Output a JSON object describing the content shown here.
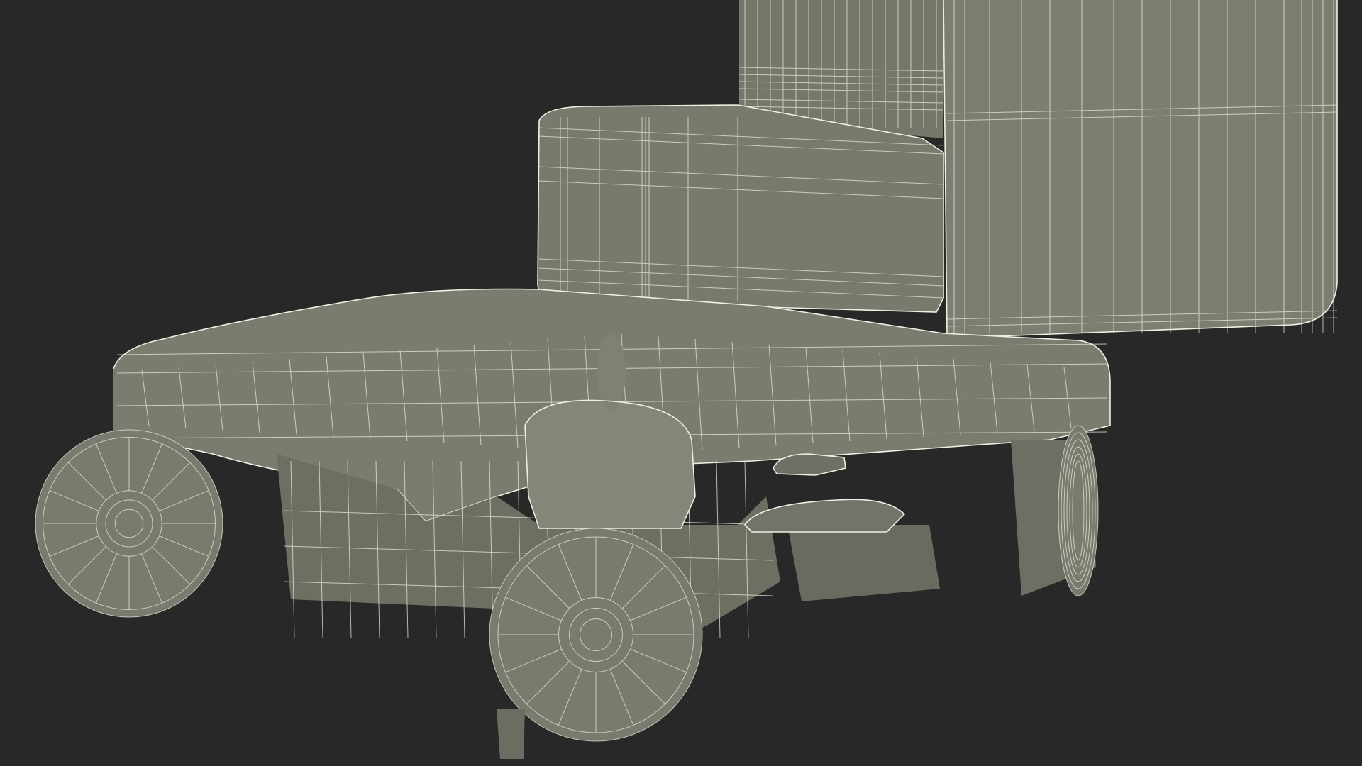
{
  "scene": {
    "background_color": "#282828",
    "mesh_color": "#7b7c70",
    "mesh_shadow_color": "#5f6055",
    "wire_color": "#e8e8d8"
  }
}
